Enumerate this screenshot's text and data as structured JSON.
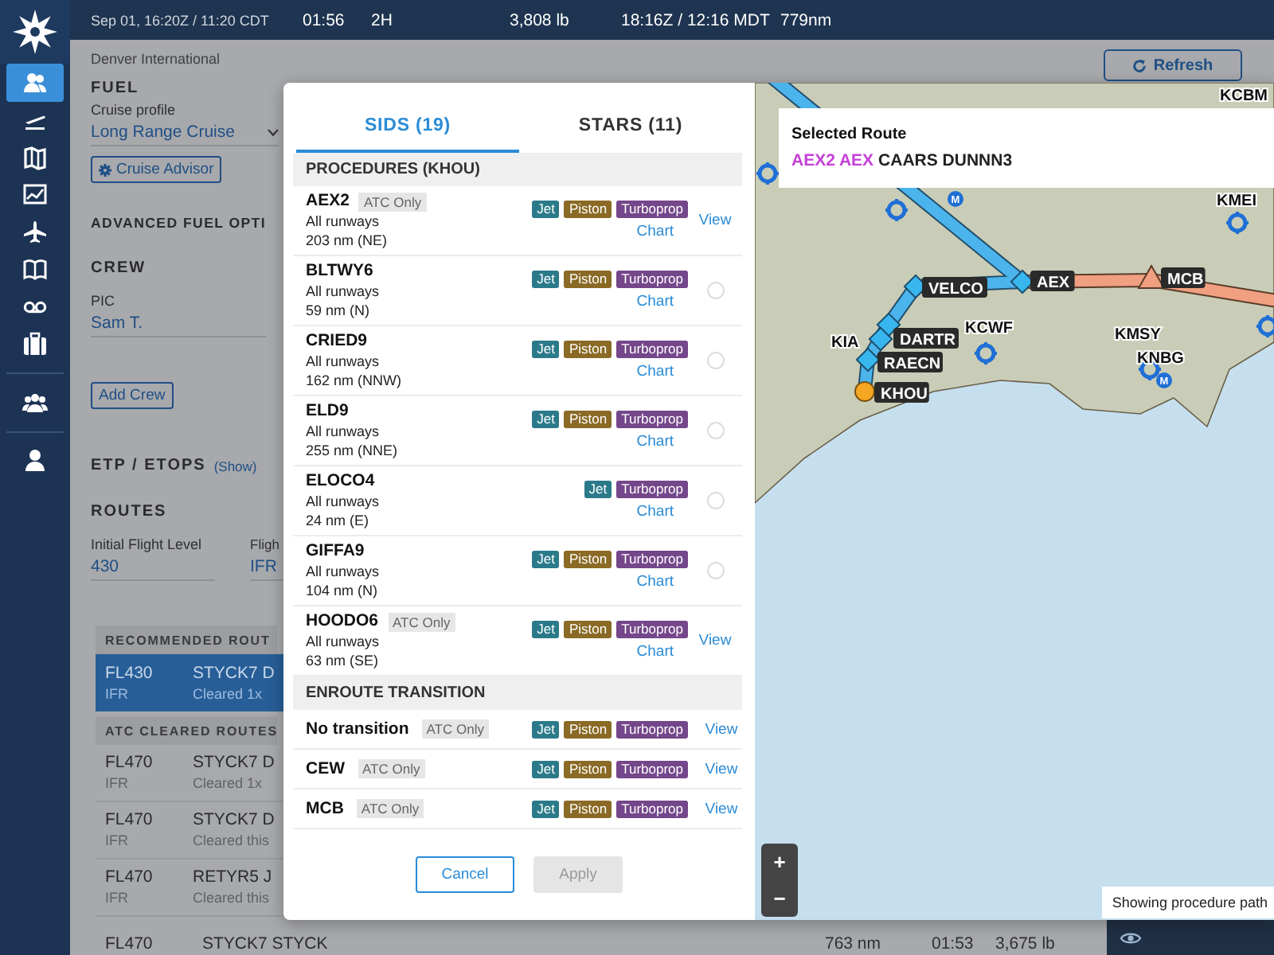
{
  "header": {
    "date": "Sep 01, 16:20Z / 11:20 CDT",
    "stats": [
      "01:56",
      "2H",
      "3,808 lb",
      "18:16Z / 12:16 MDT",
      "779nm"
    ]
  },
  "sidebar": {
    "items": [
      {
        "selected": true
      },
      {
        "selected": false
      },
      {
        "selected": false
      },
      {
        "selected": false
      },
      {
        "selected": false
      },
      {
        "selected": false
      },
      {
        "selected": false
      },
      {
        "selected": false
      },
      {
        "selected": false
      },
      {
        "selected": false
      }
    ]
  },
  "planner": {
    "airport": "Denver International",
    "refresh": "Refresh",
    "fuel": {
      "heading": "FUEL",
      "profile_label": "Cruise profile",
      "profile": "Long Range Cruise",
      "advisor": "Cruise Advisor"
    },
    "advanced_heading": "ADVANCED FUEL OPTI",
    "crew": {
      "heading": "CREW",
      "role": "PIC",
      "name": "Sam T.",
      "add": "Add Crew"
    },
    "etp": {
      "heading": "ETP / ETOPS",
      "toggle": "(Show)"
    },
    "routes": {
      "heading": "ROUTES",
      "fields": [
        {
          "label": "Initial Flight Level",
          "value": "430"
        },
        {
          "label": "Fligh",
          "value": "IFR"
        }
      ],
      "groups": [
        {
          "heading": "RECOMMENDED ROUT",
          "rows": [
            {
              "flight_level": "FL430",
              "rules": "IFR",
              "route": "STYCK7 D",
              "note": "Cleared 1x",
              "selected": true
            }
          ]
        },
        {
          "heading": "ATC CLEARED ROUTES",
          "rows": [
            {
              "flight_level": "FL470",
              "rules": "IFR",
              "route": "STYCK7 D",
              "note": "Cleared 1x",
              "selected": false
            },
            {
              "flight_level": "FL470",
              "rules": "IFR",
              "route": "STYCK7 D",
              "note": "Cleared this",
              "selected": false
            },
            {
              "flight_level": "FL470",
              "rules": "IFR",
              "route": "RETYR5 J",
              "note": "Cleared this",
              "selected": false
            }
          ]
        }
      ],
      "last_row": {
        "flight_level": "FL470",
        "route": "STYCK7 STYCK",
        "distance": "763 nm",
        "time": "01:53",
        "fuel": "3,675 lb"
      }
    }
  },
  "dialog": {
    "tabs": [
      {
        "label": "SIDS (19)",
        "selected": true
      },
      {
        "label": "STARS (11)",
        "selected": false
      }
    ],
    "procedures_heading": "PROCEDURES (KHOU)",
    "procedures": [
      {
        "name": "AEX2",
        "badge": "ATC Only",
        "runways": "All runways",
        "distance": "203 nm (NE)",
        "tags": [
          {
            "label": "Jet",
            "color": "#2b7a8a"
          },
          {
            "label": "Piston",
            "color": "#8a6a25"
          },
          {
            "label": "Turboprop",
            "color": "#74468a"
          }
        ],
        "chart": "Chart",
        "kind": "view",
        "action": "View"
      },
      {
        "name": "BLTWY6",
        "runways": "All runways",
        "distance": "59 nm (N)",
        "tags": [
          {
            "label": "Jet",
            "color": "#2b7a8a"
          },
          {
            "label": "Piston",
            "color": "#8a6a25"
          },
          {
            "label": "Turboprop",
            "color": "#74468a"
          }
        ],
        "chart": "Chart",
        "kind": "select",
        "selected": false
      },
      {
        "name": "CRIED9",
        "runways": "All runways",
        "distance": "162 nm (NNW)",
        "tags": [
          {
            "label": "Jet",
            "color": "#2b7a8a"
          },
          {
            "label": "Piston",
            "color": "#8a6a25"
          },
          {
            "label": "Turboprop",
            "color": "#74468a"
          }
        ],
        "chart": "Chart",
        "kind": "select",
        "selected": false
      },
      {
        "name": "ELD9",
        "runways": "All runways",
        "distance": "255 nm (NNE)",
        "tags": [
          {
            "label": "Jet",
            "color": "#2b7a8a"
          },
          {
            "label": "Piston",
            "color": "#8a6a25"
          },
          {
            "label": "Turboprop",
            "color": "#74468a"
          }
        ],
        "chart": "Chart",
        "kind": "select",
        "selected": false
      },
      {
        "name": "ELOCO4",
        "runways": "All runways",
        "distance": "24 nm (E)",
        "tags": [
          {
            "label": "Jet",
            "color": "#2b7a8a"
          },
          {
            "label": "Turboprop",
            "color": "#74468a"
          }
        ],
        "chart": "Chart",
        "kind": "select",
        "selected": false
      },
      {
        "name": "GIFFA9",
        "runways": "All runways",
        "distance": "104 nm (N)",
        "tags": [
          {
            "label": "Jet",
            "color": "#2b7a8a"
          },
          {
            "label": "Piston",
            "color": "#8a6a25"
          },
          {
            "label": "Turboprop",
            "color": "#74468a"
          }
        ],
        "chart": "Chart",
        "kind": "select",
        "selected": false
      },
      {
        "name": "HOODO6",
        "badge": "ATC Only",
        "runways": "All runways",
        "distance": "63 nm (SE)",
        "tags": [
          {
            "label": "Jet",
            "color": "#2b7a8a"
          },
          {
            "label": "Piston",
            "color": "#8a6a25"
          },
          {
            "label": "Turboprop",
            "color": "#74468a"
          }
        ],
        "chart": "Chart",
        "kind": "view",
        "action": "View"
      }
    ],
    "transitions_heading": "ENROUTE TRANSITION",
    "transitions": [
      {
        "name": "No transition",
        "badge": "ATC Only",
        "tags": [
          {
            "label": "Jet",
            "color": "#2b7a8a"
          },
          {
            "label": "Piston",
            "color": "#8a6a25"
          },
          {
            "label": "Turboprop",
            "color": "#74468a"
          }
        ],
        "action": "View"
      },
      {
        "name": "CEW",
        "badge": "ATC Only",
        "tags": [
          {
            "label": "Jet",
            "color": "#2b7a8a"
          },
          {
            "label": "Piston",
            "color": "#8a6a25"
          },
          {
            "label": "Turboprop",
            "color": "#74468a"
          }
        ],
        "action": "View"
      },
      {
        "name": "MCB",
        "badge": "ATC Only",
        "tags": [
          {
            "label": "Jet",
            "color": "#2b7a8a"
          },
          {
            "label": "Piston",
            "color": "#8a6a25"
          },
          {
            "label": "Turboprop",
            "color": "#74468a"
          }
        ],
        "action": "View"
      }
    ],
    "buttons": [
      {
        "label": "Cancel",
        "disabled": false
      },
      {
        "label": "Apply",
        "disabled": true
      }
    ]
  },
  "map": {
    "selected_route": {
      "title": "Selected Route",
      "parts": [
        {
          "text": "AEX2 AEX",
          "highlighted": true
        },
        {
          "text": "CAARS DUNNN3",
          "highlighted": false
        }
      ]
    },
    "labels": [
      {
        "text": "KCBM",
        "kind": "airport"
      },
      {
        "text": "KMEI",
        "kind": "airport"
      },
      {
        "text": "VELCO",
        "kind": "fix"
      },
      {
        "text": "AEX",
        "kind": "fix"
      },
      {
        "text": "MCB",
        "kind": "fix"
      },
      {
        "text": "KIA",
        "kind": "airport"
      },
      {
        "text": "DARTR",
        "kind": "fix"
      },
      {
        "text": "KCWF",
        "kind": "airport"
      },
      {
        "text": "KMSY",
        "kind": "airport"
      },
      {
        "text": "RAECN",
        "kind": "fix"
      },
      {
        "text": "KNBG",
        "kind": "airport"
      },
      {
        "text": "KHOU",
        "kind": "fix"
      }
    ],
    "metro_markers": [
      {
        "text": "M"
      },
      {
        "text": "M"
      }
    ],
    "zoom_in": "+",
    "zoom_out": "−",
    "status": "Showing procedure path"
  }
}
